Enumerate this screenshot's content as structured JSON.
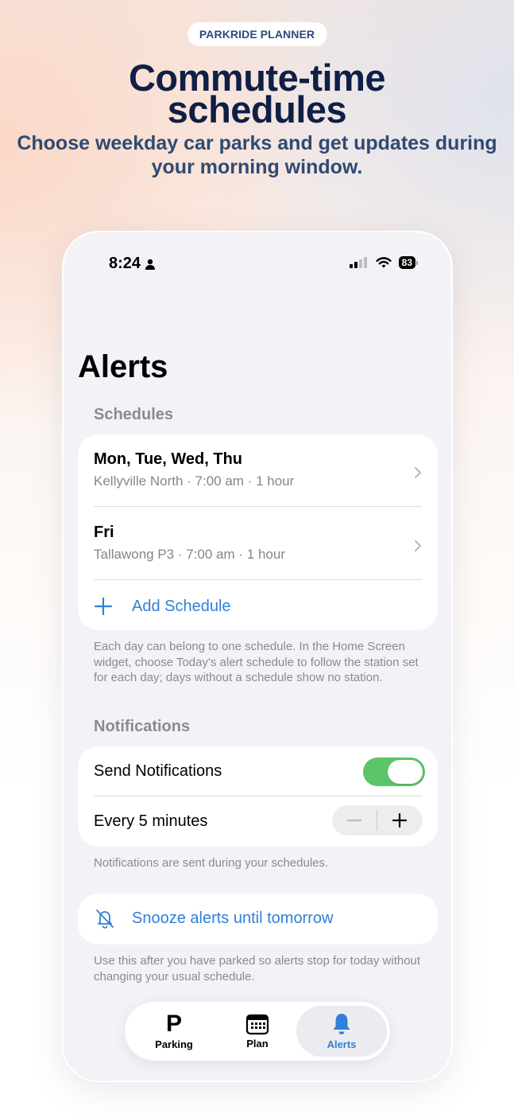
{
  "promo": {
    "badge": "PARKRIDE PLANNER",
    "headline_line1": "Commute-time",
    "headline_line2": "schedules",
    "subhead": "Choose weekday car parks and get updates during your morning window."
  },
  "status_bar": {
    "time": "8:24",
    "battery": "83"
  },
  "screen": {
    "title": "Alerts",
    "schedules": {
      "header": "Schedules",
      "items": [
        {
          "title": "Mon, Tue, Wed, Thu",
          "subtitle": "Kellyville North · 7:00 am · 1 hour"
        },
        {
          "title": "Fri",
          "subtitle": "Tallawong P3 · 7:00 am · 1 hour"
        }
      ],
      "add_label": "Add Schedule",
      "footer": "Each day can belong to one schedule. In the Home Screen widget, choose Today's alert schedule to follow the station set for each day; days without a schedule show no station."
    },
    "notifications": {
      "header": "Notifications",
      "send_label": "Send Notifications",
      "send_enabled": true,
      "interval_label": "Every 5 minutes",
      "footer": "Notifications are sent during your schedules."
    },
    "snooze": {
      "label": "Snooze alerts until tomorrow",
      "footer": "Use this after you have parked so alerts stop for today without changing your usual schedule."
    }
  },
  "tabbar": {
    "tabs": [
      {
        "label": "Parking",
        "icon": "P"
      },
      {
        "label": "Plan"
      },
      {
        "label": "Alerts"
      }
    ],
    "active": "Alerts"
  },
  "colors": {
    "accent": "#2f80d8",
    "toggle_on": "#5bc568",
    "headline": "#0f1f45"
  }
}
